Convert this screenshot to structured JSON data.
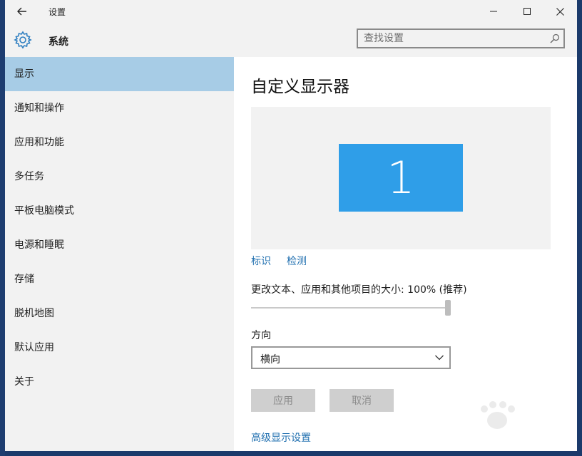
{
  "window": {
    "title": "设置"
  },
  "header": {
    "section_title": "系统",
    "search": {
      "placeholder": "查找设置",
      "value": ""
    }
  },
  "sidebar": {
    "items": [
      {
        "label": "显示",
        "active": true
      },
      {
        "label": "通知和操作"
      },
      {
        "label": "应用和功能"
      },
      {
        "label": "多任务"
      },
      {
        "label": "平板电脑模式"
      },
      {
        "label": "电源和睡眠"
      },
      {
        "label": "存储"
      },
      {
        "label": "脱机地图"
      },
      {
        "label": "默认应用"
      },
      {
        "label": "关于"
      }
    ]
  },
  "main": {
    "page_title": "自定义显示器",
    "monitor_number": "1",
    "identify_link": "标识",
    "detect_link": "检测",
    "scale_label": "更改文本、应用和其他项目的大小: 100% (推荐)",
    "scale_slider_fraction": 1.0,
    "orientation_label": "方向",
    "orientation_value": "横向",
    "apply_button": "应用",
    "cancel_button": "取消",
    "advanced_link": "高级显示设置"
  },
  "colors": {
    "accent_active_item": "#a7cce6",
    "monitor_tile": "#2f9ee8",
    "link": "#2170b0"
  }
}
